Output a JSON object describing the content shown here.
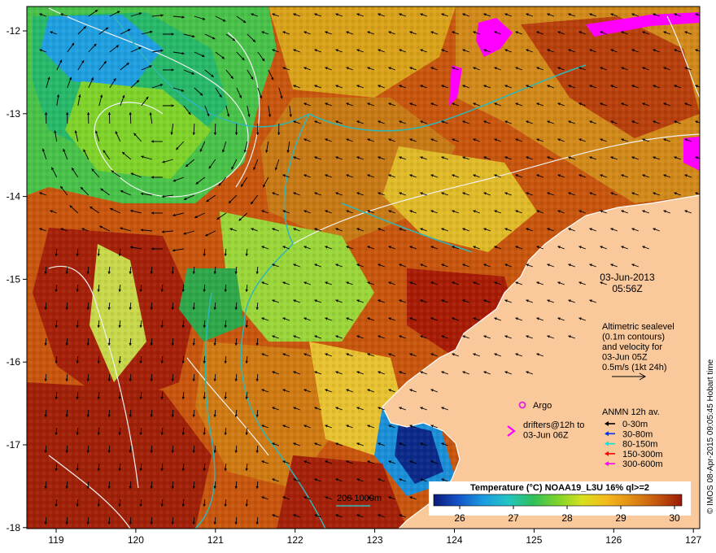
{
  "map": {
    "x_ticks": [
      "119",
      "120",
      "121",
      "122",
      "123",
      "124",
      "125",
      "126",
      "127"
    ],
    "y_ticks": [
      "-12",
      "-13",
      "-14",
      "-15",
      "-16",
      "-17",
      "-18"
    ],
    "land_color": "#f9c89b",
    "coast_color": "#ffffff",
    "contour_color": "#f2f2f2",
    "isobath_color": "#2fb7b7"
  },
  "info": {
    "date": "03-Jun-2013",
    "time": "05:56Z",
    "altimetry_lines": [
      "Altimetric sealevel",
      "(0.1m contours)",
      "and velocity for",
      "03-Jun 05Z",
      "0.5m/s (1kt 24h)"
    ]
  },
  "legend": {
    "argo": "Argo",
    "drifters_lines": [
      "drifters@12h to",
      "03-Jun 06Z"
    ],
    "anmn_title": "ANMN 12h av.",
    "depths": [
      {
        "label": "0-30m",
        "color": "#000000"
      },
      {
        "label": "30-80m",
        "color": "#0033ff"
      },
      {
        "label": "80-150m",
        "color": "#00e5e5"
      },
      {
        "label": "150-300m",
        "color": "#ff0000"
      },
      {
        "label": "300-600m",
        "color": "#ff00ff"
      }
    ],
    "isobath_label": "200  1000m",
    "argo_color": "#e020e0",
    "drifter_color": "#ff00ff"
  },
  "colorbar": {
    "title": "Temperature (°C) NOAA19_L3U 16% ql>=2",
    "ticks": [
      "26",
      "27",
      "28",
      "29",
      "30"
    ],
    "colors": [
      "#0a1a7a",
      "#1454c8",
      "#1a9be0",
      "#22c4c4",
      "#2fbf5a",
      "#7fd32a",
      "#d8e01e",
      "#f5b81c",
      "#e08a14",
      "#c4580e",
      "#9a1a06"
    ]
  },
  "credit": "© IMOS 08-Apr-2015 09:05:45 Hobart time"
}
